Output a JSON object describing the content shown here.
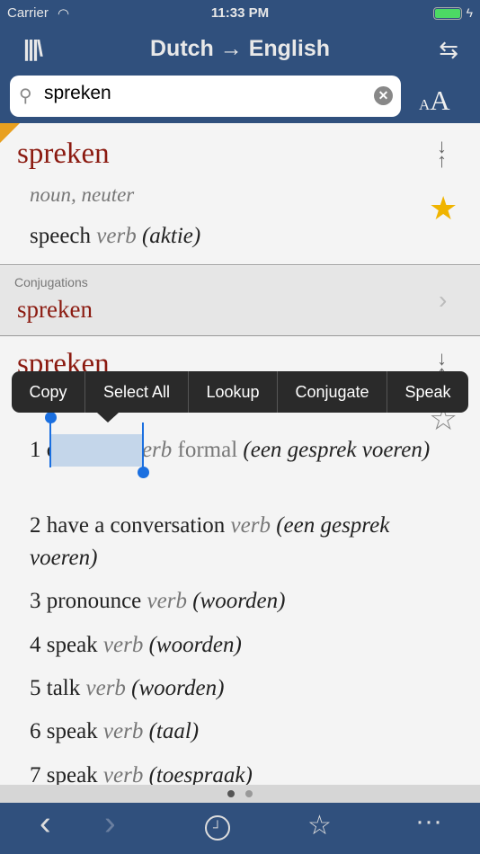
{
  "status": {
    "carrier": "Carrier",
    "time": "11:33 PM"
  },
  "nav": {
    "title": "Dutch → English",
    "library_icon": "library-icon",
    "swap_icon": "swap-icon"
  },
  "search": {
    "value": "spreken",
    "font_small": "A",
    "font_large": "A"
  },
  "entry1": {
    "headword": "spreken",
    "grammar": "noun, neuter",
    "translation": "speech",
    "pos": "verb",
    "context": "(aktie)",
    "favorited": true
  },
  "conjugations": {
    "label": "Conjugations",
    "word": "spreken"
  },
  "entry2": {
    "headword": "spreken",
    "favorited": false,
    "senses": [
      {
        "num": "1",
        "word": "converse",
        "pos": "verb",
        "register": "formal",
        "context": "(een gesprek voeren)"
      },
      {
        "num": "2",
        "word": "have a conversation",
        "pos": "verb",
        "context": "(een gesprek voeren)"
      },
      {
        "num": "3",
        "word": "pronounce",
        "pos": "verb",
        "context": "(woorden)"
      },
      {
        "num": "4",
        "word": "speak",
        "pos": "verb",
        "context": "(woorden)"
      },
      {
        "num": "5",
        "word": "talk",
        "pos": "verb",
        "context": "(woorden)"
      },
      {
        "num": "6",
        "word": "speak",
        "pos": "verb",
        "context": "(taal)"
      },
      {
        "num": "7",
        "word": "speak",
        "pos": "verb",
        "context": "(toespraak)"
      }
    ]
  },
  "menu": [
    "Copy",
    "Select All",
    "Lookup",
    "Conjugate",
    "Speak"
  ],
  "pager": {
    "pages": 2,
    "current": 1
  },
  "colors": {
    "bar": "#30507d",
    "headword": "#8b1a10",
    "selection": "#1a6fe0"
  }
}
